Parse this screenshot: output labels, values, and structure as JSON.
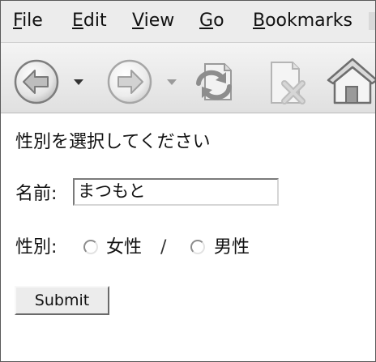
{
  "menu": {
    "items": [
      {
        "mnemonic": "F",
        "rest": "ile"
      },
      {
        "mnemonic": "E",
        "rest": "dit"
      },
      {
        "mnemonic": "V",
        "rest": "iew"
      },
      {
        "mnemonic": "G",
        "rest": "o"
      },
      {
        "mnemonic": "B",
        "rest": "ookmarks"
      }
    ]
  },
  "toolbar": {
    "buttons": [
      "back-icon",
      "dropdown-arrow-icon",
      "forward-icon",
      "dropdown-arrow-icon",
      "reload-icon",
      "stop-icon",
      "home-icon"
    ]
  },
  "page": {
    "heading": "性別を選択してください",
    "name_label": "名前:",
    "name_value": "まつもと",
    "gender_label": "性別:",
    "options": [
      "女性",
      "男性"
    ],
    "separator": "/",
    "submit_label": "Submit"
  },
  "colors": {
    "chrome_background": "#ececec",
    "toolbar_icon": "#9a9a9a",
    "text": "#111111"
  }
}
